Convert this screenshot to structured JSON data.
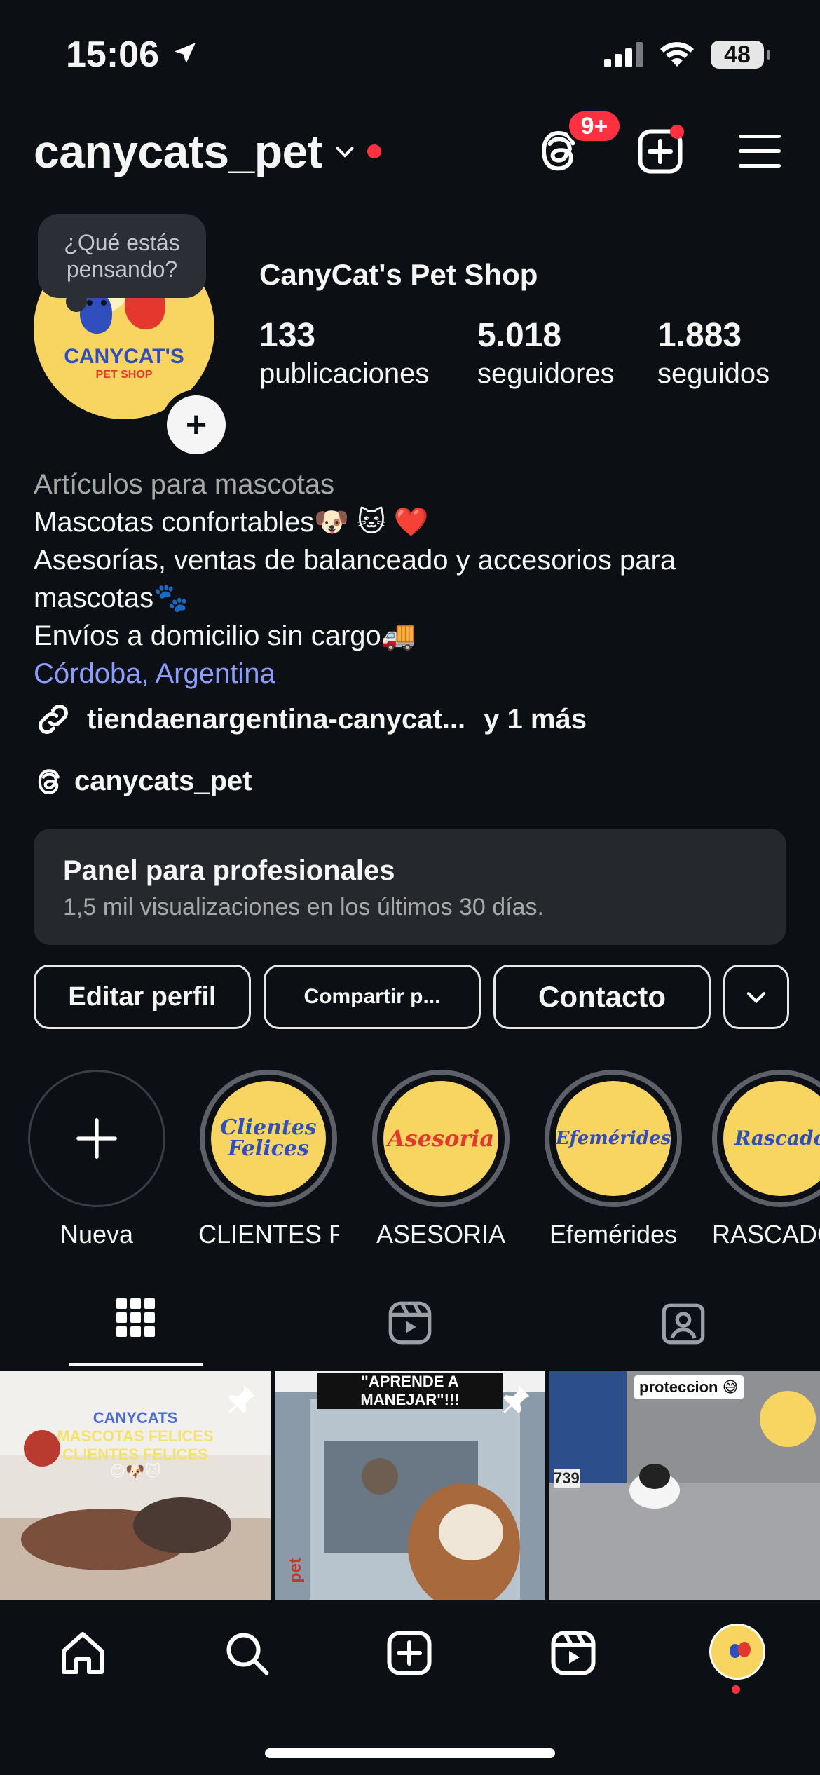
{
  "status_bar": {
    "time": "15:06",
    "battery": "48"
  },
  "header": {
    "username": "canycats_pet",
    "notifications_badge": "9+"
  },
  "profile": {
    "tooltip": "¿Qué estás pensando?",
    "display_name": "CanyCat's Pet Shop",
    "avatar_brand": "CANYCAT'S",
    "avatar_sub": "PET SHOP",
    "stats": [
      {
        "value": "133",
        "label": "publicaciones"
      },
      {
        "value": "5.018",
        "label": "seguidores"
      },
      {
        "value": "1.883",
        "label": "seguidos"
      }
    ],
    "bio": {
      "category": "Artículos para mascotas",
      "line1": "Mascotas confortables🐶 🐱 ❤️",
      "line2": "Asesorías, ventas de balanceado y accesorios para mascotas🐾",
      "line3": "Envíos a domicilio sin cargo🚚",
      "location": "Córdoba, Argentina"
    },
    "link": {
      "text": "tiendaenargentina-canycat...",
      "more": "y 1 más"
    },
    "threads_handle": "canycats_pet"
  },
  "panel": {
    "title": "Panel para profesionales",
    "subtitle": "1,5 mil visualizaciones en los últimos 30 días."
  },
  "buttons": {
    "edit": "Editar perfil",
    "share": "Compartir p...",
    "contact": "Contacto"
  },
  "highlights": [
    {
      "label": "Nueva",
      "cover": ""
    },
    {
      "label": "CLIENTES F...",
      "cover": "Clientes Felices"
    },
    {
      "label": "ASESORIA",
      "cover": "Asesoria"
    },
    {
      "label": "Efemérides",
      "cover": "Efemérides"
    },
    {
      "label": "RASCADO",
      "cover": "Rascador"
    }
  ],
  "grid": [
    {
      "caption1": "CANYCATS",
      "caption2": "MASCOTAS FELICES",
      "caption3": "CLIENTES FELICES",
      "caption4": "😊🐶🐱"
    },
    {
      "caption1": "\"APRENDE A MANEJAR\"!!!",
      "caption2": "pet"
    },
    {
      "caption1": "proteccion 😅",
      "caption2": "739"
    }
  ],
  "colors": {
    "background": "#0c1014",
    "accent_red": "#ff3040",
    "link_blue": "#8c9cff",
    "brand_yellow": "#f8d560"
  }
}
